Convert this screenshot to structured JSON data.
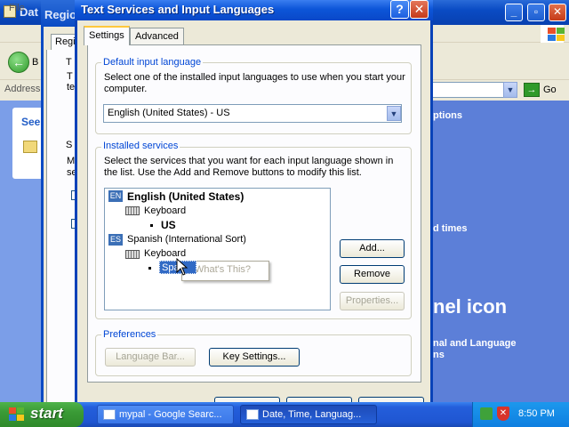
{
  "background_window": {
    "title_fragment": "Dat",
    "menu_fragment": "File",
    "back_label_fragment": "B",
    "address_label_fragment": "Address",
    "go_label": "Go",
    "left_card_title_fragment": "See",
    "right_pane_texts": [
      "ptions",
      "d times",
      "nel icon",
      "nal and Language",
      "ns"
    ]
  },
  "regional_dialog": {
    "title_fragment": "Regio",
    "tab_fragment": "Regi",
    "fragments": [
      "T",
      "T",
      "te",
      "S",
      "M",
      "se"
    ]
  },
  "dialog": {
    "title": "Text Services and Input Languages",
    "help_glyph": "?",
    "close_glyph": "✕",
    "tabs": [
      {
        "label": "Settings",
        "active": true
      },
      {
        "label": "Advanced",
        "active": false
      }
    ],
    "default_input": {
      "group_label": "Default input language",
      "description": "Select one of the installed input languages to use when you start your computer.",
      "selected_value": "English (United States) - US"
    },
    "installed_services": {
      "group_label": "Installed services",
      "description": "Select the services that you want for each input language shown in the list. Use the Add and Remove buttons to modify this list.",
      "languages": [
        {
          "badge": "EN",
          "name": "English (United States)",
          "bold": true,
          "keyboard_label": "Keyboard",
          "layout": "US"
        },
        {
          "badge": "ES",
          "name": "Spanish (International Sort)",
          "bold": false,
          "keyboard_label": "Keyboard",
          "layout": "Spanish"
        }
      ],
      "add_button": "Add...",
      "remove_button": "Remove",
      "properties_button": "Properties..."
    },
    "preferences": {
      "group_label": "Preferences",
      "language_bar_button": "Language Bar...",
      "key_settings_button": "Key Settings..."
    },
    "context_menu": {
      "item": "What's This?"
    },
    "selected_item_fragment": "Spa"
  },
  "taskbar": {
    "start_label": "start",
    "tasks": [
      {
        "label": "mypal - Google Searc...",
        "active": false
      },
      {
        "label": "Date, Time, Languag...",
        "active": true
      }
    ],
    "clock": "8:50 PM"
  },
  "colors": {
    "titlebar_blue": "#0a4bc4",
    "group_label_blue": "#0046d5",
    "selection_blue": "#316ac5",
    "close_red": "#c53a1a",
    "start_green": "#3a9a36"
  }
}
